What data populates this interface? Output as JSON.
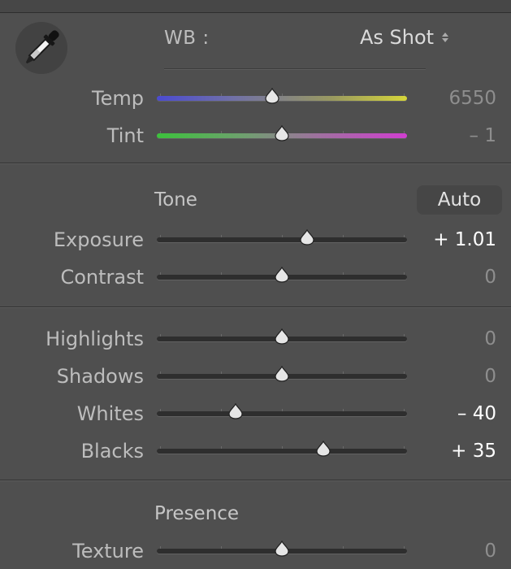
{
  "white_balance": {
    "label": "WB :",
    "selected": "As Shot",
    "eyedropper_icon": "eyedropper-icon",
    "sliders": [
      {
        "key": "temp",
        "label": "Temp",
        "value": "6550",
        "position": 0.46,
        "value_style": "dim",
        "track": "temp"
      },
      {
        "key": "tint",
        "label": "Tint",
        "value": "– 1",
        "position": 0.5,
        "value_style": "dim",
        "track": "tint"
      }
    ]
  },
  "tone": {
    "title": "Tone",
    "auto_label": "Auto",
    "sliders": [
      {
        "key": "exposure",
        "label": "Exposure",
        "value": "+ 1.01",
        "position": 0.6,
        "value_style": "bright"
      },
      {
        "key": "contrast",
        "label": "Contrast",
        "value": "0",
        "position": 0.5,
        "value_style": "dim"
      }
    ]
  },
  "tone_regions": {
    "sliders": [
      {
        "key": "highlights",
        "label": "Highlights",
        "value": "0",
        "position": 0.5,
        "value_style": "dim"
      },
      {
        "key": "shadows",
        "label": "Shadows",
        "value": "0",
        "position": 0.5,
        "value_style": "dim"
      },
      {
        "key": "whites",
        "label": "Whites",
        "value": "– 40",
        "position": 0.315,
        "value_style": "bright"
      },
      {
        "key": "blacks",
        "label": "Blacks",
        "value": "+ 35",
        "position": 0.665,
        "value_style": "bright"
      }
    ]
  },
  "presence": {
    "title": "Presence",
    "sliders": [
      {
        "key": "texture",
        "label": "Texture",
        "value": "0",
        "position": 0.5,
        "value_style": "dim"
      }
    ]
  },
  "colors": {
    "panel_bg": "#4f4f4f",
    "label_text": "#bdbdbd",
    "value_dim": "#8e8e8e",
    "value_bright": "#ffffff",
    "temp_gradient": [
      "#4b4bd0",
      "#d6d63a"
    ],
    "tint_gradient": [
      "#3cc23c",
      "#d03ed0"
    ]
  }
}
